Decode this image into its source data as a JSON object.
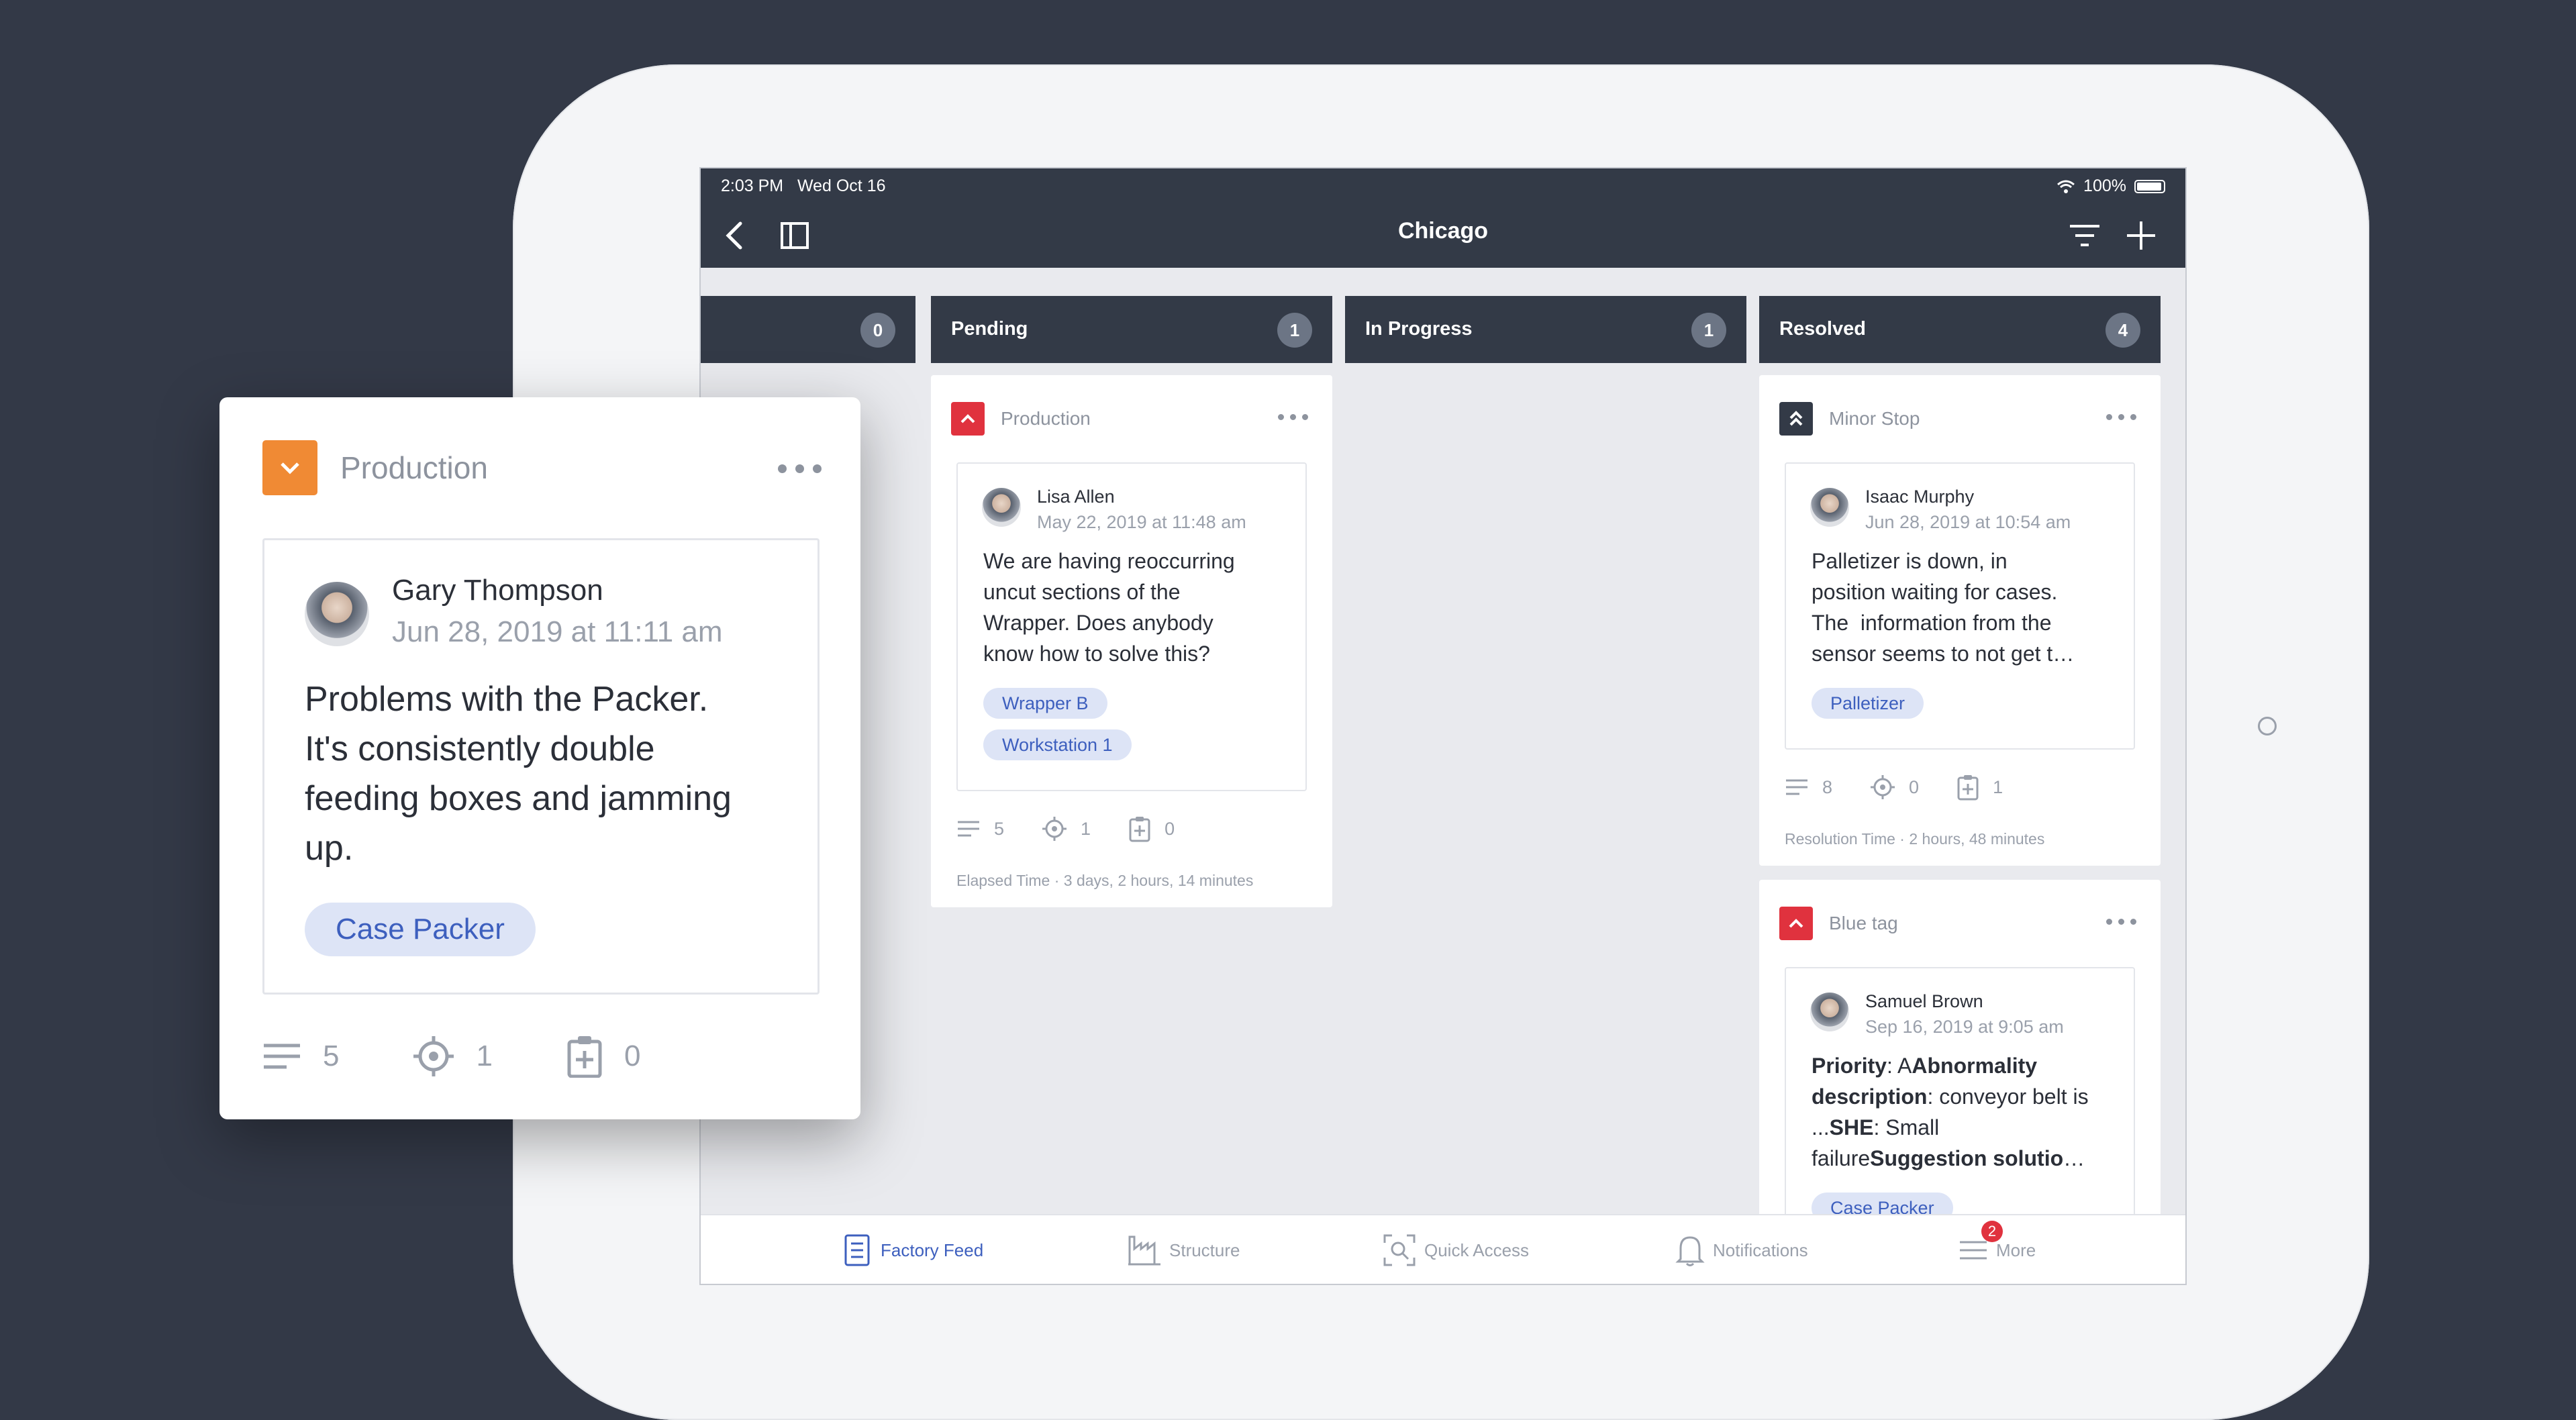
{
  "status": {
    "time": "2:03 PM",
    "date": "Wed Oct 16",
    "battery": "100%"
  },
  "header": {
    "title": "Chicago"
  },
  "columns": [
    {
      "label": "",
      "count": "0"
    },
    {
      "label": "Pending",
      "count": "1"
    },
    {
      "label": "In Progress",
      "count": "1"
    },
    {
      "label": "Resolved",
      "count": "4"
    }
  ],
  "pending_card": {
    "category": "Production",
    "author": "Lisa Allen",
    "date": "May 22, 2019 at 11:48 am",
    "lines": [
      "We are having reoccurring",
      "uncut sections of the",
      "Wrapper. Does anybody",
      "know how to solve this?"
    ],
    "tags": [
      "Wrapper B",
      "Workstation 1"
    ],
    "comments": "5",
    "targets": "1",
    "tasks": "0",
    "meta": "Elapsed Time · 3 days, 2 hours, 14 minutes"
  },
  "resolved_card_1": {
    "category": "Minor Stop",
    "author": "Isaac Murphy",
    "date": "Jun 28, 2019 at 10:54 am",
    "lines": [
      "Palletizer is down, in",
      "position waiting for cases.",
      "The  information from the",
      "sensor seems to not get t…"
    ],
    "tags": [
      "Palletizer"
    ],
    "comments": "8",
    "targets": "0",
    "tasks": "1",
    "meta": "Resolution Time · 2 hours, 48 minutes"
  },
  "resolved_card_2": {
    "category": "Blue tag",
    "author": "Samuel Brown",
    "date": "Sep 16, 2019 at 9:05 am",
    "line1_bold": "Priority",
    "line1_rest": ": A",
    "line1_bold2": "Abnormality",
    "line2_bold": "description",
    "line2_rest": ": conveyor belt is",
    "line3_pre": "...",
    "line3_bold": "SHE",
    "line3_rest": ": Small",
    "line4_pre": "failure",
    "line4_bold": "Suggestion solutio",
    "line4_rest": "…",
    "tags": [
      "Case Packer"
    ]
  },
  "float_card": {
    "category": "Production",
    "author": "Gary Thompson",
    "date": "Jun 28, 2019 at 11:11 am",
    "lines": [
      "Problems with the Packer.",
      "It's consistently double",
      "feeding boxes and jamming",
      "up."
    ],
    "tags": [
      "Case Packer"
    ],
    "comments": "5",
    "targets": "1",
    "tasks": "0"
  },
  "tabs": [
    {
      "label": "Factory Feed",
      "icon": "document-icon",
      "active": true
    },
    {
      "label": "Structure",
      "icon": "factory-icon"
    },
    {
      "label": "Quick Access",
      "icon": "scan-icon"
    },
    {
      "label": "Notifications",
      "icon": "bell-icon"
    },
    {
      "label": "More",
      "icon": "menu-icon",
      "badge": "2"
    }
  ],
  "colors": {
    "header_bg": "#333a47",
    "accent": "#3d5fbe",
    "red": "#e0323e",
    "orange": "#f08a34",
    "tag_bg": "#dde4f6"
  }
}
